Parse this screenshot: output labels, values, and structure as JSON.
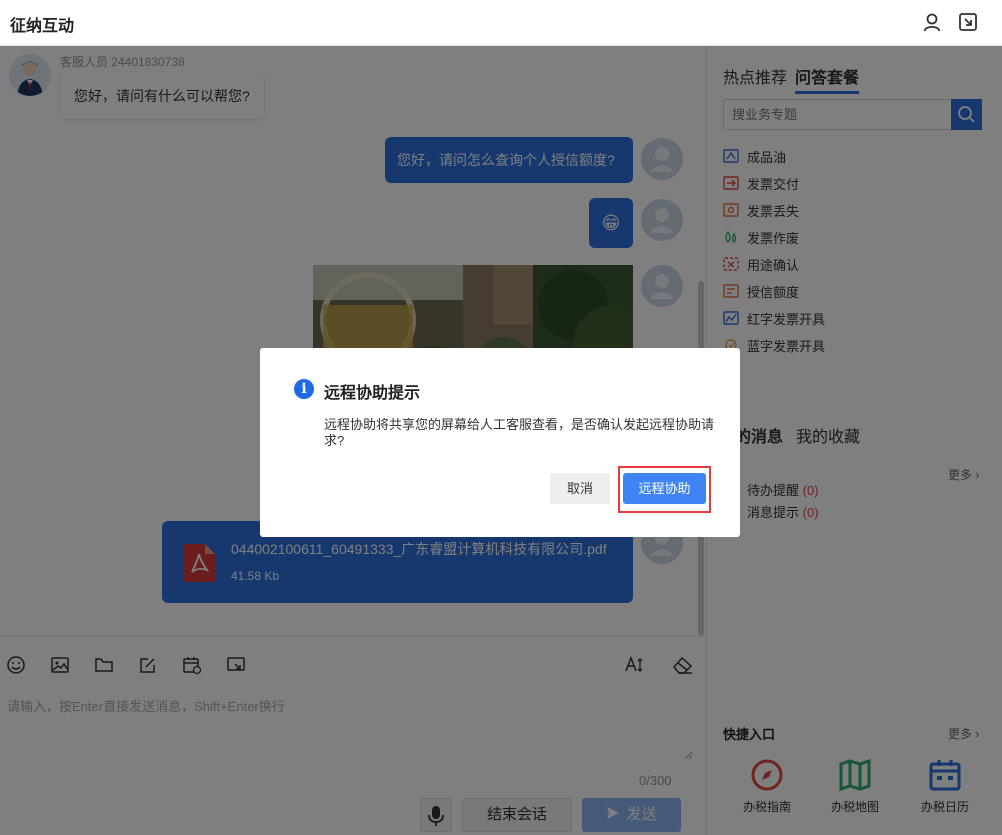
{
  "window": {
    "title": "征纳互动"
  },
  "chat": {
    "agent_name": "客服人员 24401830738",
    "agent_greeting": "您好，请问有什么可以帮您?",
    "user_message": "您好，请问怎么查询个人授信额度?",
    "emoji": "😁",
    "file": {
      "name": "044002100611_60491333_广东睿盟计算机科技有限公司.pdf",
      "size": "41.58 Kb"
    }
  },
  "input": {
    "placeholder": "请输入，按Enter直接发送消息，Shift+Enter换行",
    "counter": "0/300",
    "end_label": "结束会话",
    "send_label": "发送"
  },
  "sidebar": {
    "tabs": [
      "热点推荐",
      "问答套餐"
    ],
    "active_tab": "问答套餐",
    "search_placeholder": "搜业务专题",
    "topics": [
      {
        "label": "成品油",
        "icon": "oil-icon",
        "color": "#2f6fde"
      },
      {
        "label": "发票交付",
        "icon": "invoice-deliver-icon",
        "color": "#e0493c"
      },
      {
        "label": "发票丢失",
        "icon": "invoice-lost-icon",
        "color": "#e8703a"
      },
      {
        "label": "发票作废",
        "icon": "invoice-void-icon",
        "color": "#2fae6a"
      },
      {
        "label": "用途确认",
        "icon": "purpose-confirm-icon",
        "color": "#e0493c"
      },
      {
        "label": "授信额度",
        "icon": "credit-limit-icon",
        "color": "#e8703a"
      },
      {
        "label": "红字发票开具",
        "icon": "red-invoice-icon",
        "color": "#2f6fde"
      },
      {
        "label": "蓝字发票开具",
        "icon": "blue-invoice-icon",
        "color": "#e8a23a"
      }
    ],
    "msg_tabs": [
      "我的消息",
      "我的收藏"
    ],
    "msg_tabs_visible": [
      "的消息",
      "我的收藏"
    ],
    "more_label": "更多",
    "messages": [
      {
        "label": "待办提醒",
        "count": "(0)"
      },
      {
        "label": "消息提示",
        "count": "(0)"
      }
    ],
    "quick_title": "快捷入口",
    "quick_more": "更多",
    "quick_links": [
      {
        "label": "办税指南",
        "icon": "compass-icon",
        "color": "#e0493c"
      },
      {
        "label": "办税地图",
        "icon": "map-icon",
        "color": "#2fae6a"
      },
      {
        "label": "办税日历",
        "icon": "calendar-icon",
        "color": "#2f6fde"
      }
    ]
  },
  "dialog": {
    "title": "远程协助提示",
    "message": "远程协助将共享您的屏幕给人工客服查看，是否确认发起远程协助请求?",
    "cancel_label": "取消",
    "confirm_label": "远程协助"
  }
}
